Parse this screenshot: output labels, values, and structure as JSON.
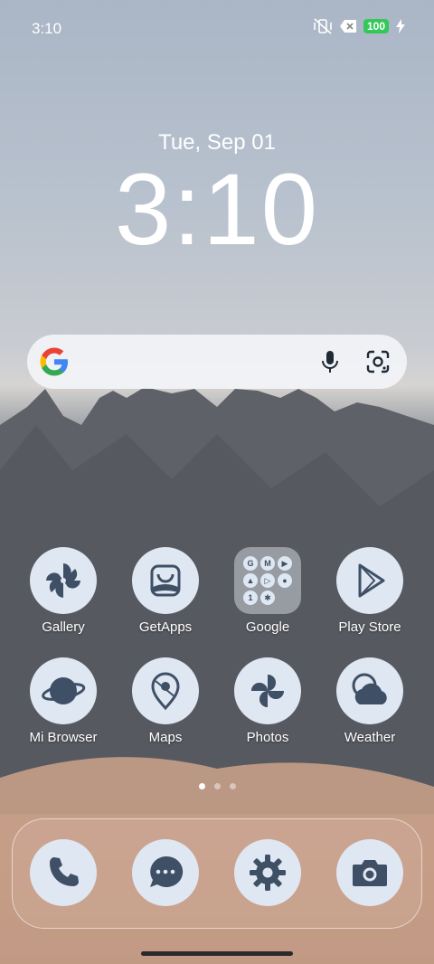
{
  "status_bar": {
    "time": "3:10",
    "battery": "100"
  },
  "lockscreen": {
    "date": "Tue, Sep 01",
    "clock": "3:10"
  },
  "search_bar": {
    "logo": "G"
  },
  "apps": [
    {
      "label": "Gallery",
      "icon": "pinwheel-icon"
    },
    {
      "label": "GetApps",
      "icon": "shopping-bag-icon"
    },
    {
      "label": "Google",
      "icon": "folder-icon"
    },
    {
      "label": "Play Store",
      "icon": "play-icon"
    },
    {
      "label": "Mi Browser",
      "icon": "planet-icon"
    },
    {
      "label": "Maps",
      "icon": "map-pin-icon"
    },
    {
      "label": "Photos",
      "icon": "pinwheel-icon"
    },
    {
      "label": "Weather",
      "icon": "cloud-icon"
    }
  ],
  "google_folder": [
    "G",
    "M",
    "▶",
    "▲",
    "▷",
    "●",
    "1",
    "✱"
  ],
  "dock": [
    {
      "name": "phone",
      "icon": "phone-icon"
    },
    {
      "name": "messages",
      "icon": "chat-icon"
    },
    {
      "name": "settings",
      "icon": "gear-icon"
    },
    {
      "name": "camera",
      "icon": "camera-icon"
    }
  ],
  "colors": {
    "icon_bg": "#dfe7f2",
    "icon_fg": "#3f5066",
    "battery_green": "#34c759"
  }
}
